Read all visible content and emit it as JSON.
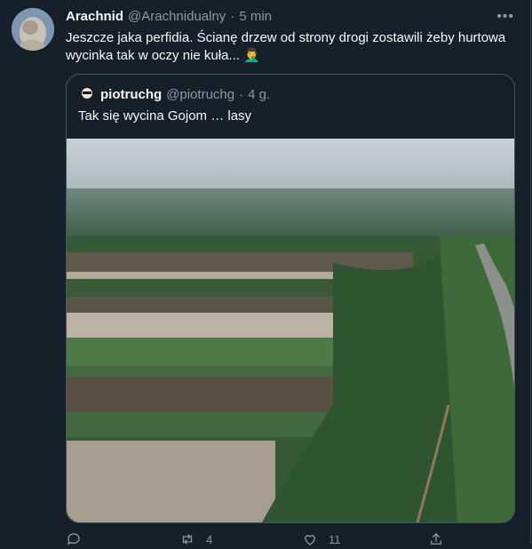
{
  "tweet": {
    "author_name": "Arachnid",
    "author_handle": "@Arachnidualny",
    "separator": "·",
    "time": "5 min",
    "text": "Jeszcze jaka perfidia. Ścianę drzew od strony drogi zostawili żeby hurtowa wycinka tak w oczy nie kuła... 🤦‍♂️",
    "more_icon": "more-dots-icon"
  },
  "quoted": {
    "author_name": "piotruchg",
    "author_handle": "@piotruchg",
    "separator": "·",
    "time": "4 g.",
    "text": "Tak się wycina Gojom … lasy"
  },
  "actions": {
    "reply_icon": "reply-icon",
    "retweet_icon": "retweet-icon",
    "retweet_count": "4",
    "like_icon": "heart-icon",
    "like_count": "11",
    "share_icon": "share-icon"
  },
  "colors": {
    "background": "#15202b",
    "text": "#f7f9f9",
    "muted": "#8b98a5",
    "border": "#425364"
  }
}
